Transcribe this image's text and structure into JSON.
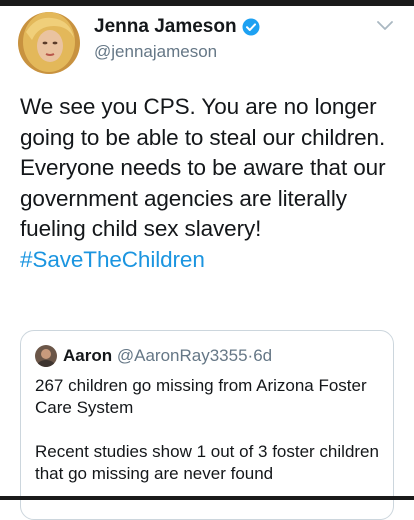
{
  "tweet": {
    "display_name": "Jenna Jameson",
    "handle": "@jennajameson",
    "text": "We see you CPS. You are no longer going to be able to steal our children. Everyone needs to be aware that our government agencies are literally fueling child sex slavery!",
    "hashtag": "#SaveTheChildren",
    "verified_icon": "verified-badge-icon",
    "menu_icon": "chevron-down-icon",
    "accent_color": "#1b95e0"
  },
  "quoted_tweet": {
    "display_name": "Aaron",
    "handle": "@AaronRay3355",
    "separator": "·",
    "time": "6d",
    "paragraphs": [
      "267 children go missing from Arizona Foster Care System",
      "Recent studies show 1 out of 3 foster children that go missing are never found"
    ]
  }
}
